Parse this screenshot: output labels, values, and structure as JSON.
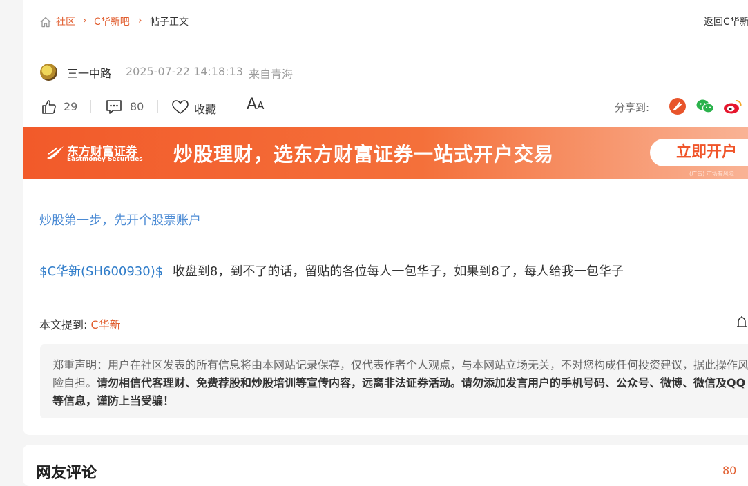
{
  "breadcrumb": {
    "home": "社区",
    "forum": "C华新吧",
    "current": "帖子正文",
    "back": "返回C华新"
  },
  "author": {
    "name": "三一中路",
    "time": "2025-07-22 14:18:13",
    "location": "来自青海"
  },
  "actions": {
    "likes": "29",
    "comments": "80",
    "favorite": "收藏",
    "font_big": "A",
    "font_small": "A",
    "share_label": "分享到:"
  },
  "banner": {
    "logo_cn": "东方财富证券",
    "logo_en": "Eastmoney Securities",
    "slogan": "炒股理财，选东方财富证券一站式开户交易",
    "button": "立即开户",
    "ad_tag": "广告",
    "ad_note": "市场有风险"
  },
  "post": {
    "promo_link": "炒股第一步，先开个股票账户",
    "stock_tag": "$C华新(SH600930)$",
    "text": "收盘到8，到不了的话，留贴的各位每人一包华子，如果到8了，每人给我一包华子",
    "mention_label": "本文提到:",
    "mention_stock": "C华新"
  },
  "disclaimer": {
    "normal": "郑重声明：用户在社区发表的所有信息将由本网站记录保存，仅代表作者个人观点，与本网站立场无关，不对您构成任何投资建议，据此操作风险自担。",
    "bold": "请勿相信代客理财、免费荐股和炒股培训等宣传内容，远离非法证券活动。请勿添加发言用户的手机号码、公众号、微博、微信及QQ等信息，谨防上当受骗！"
  },
  "comments": {
    "title": "网友评论",
    "count_partial": "80"
  },
  "colors": {
    "accent": "#e15e2f",
    "link_blue": "#2f7cc9",
    "banner": "#f25a2a"
  }
}
